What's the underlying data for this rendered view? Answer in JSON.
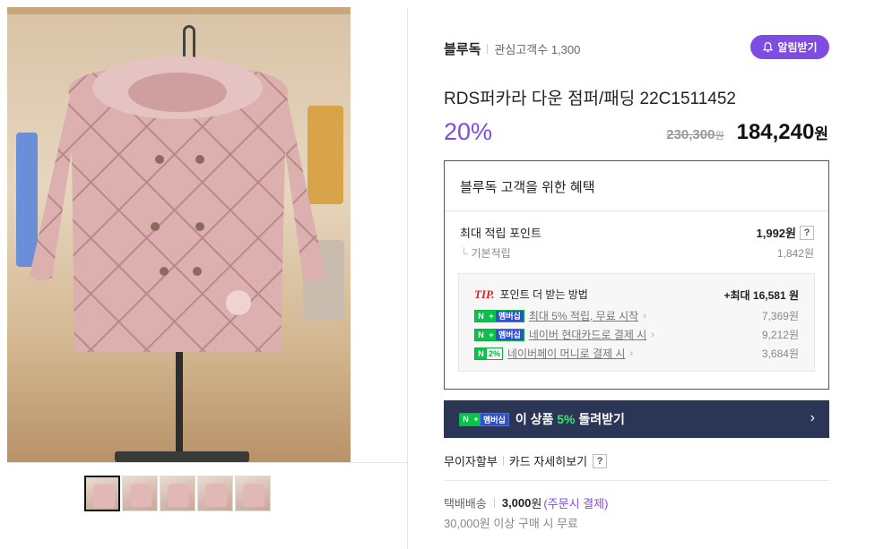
{
  "brand": {
    "name": "블루독",
    "fans_label": "관심고객수 1,300",
    "alarm_button": "알림받기",
    "accent_color": "#7e4ce0"
  },
  "product": {
    "title": "RDS퍼카라 다운 점퍼/패딩 22C1511452",
    "discount": "20%",
    "original_price": "230,300",
    "original_unit": "원",
    "sale_price": "184,240",
    "sale_unit": "원"
  },
  "gallery": {
    "main_image": "pink-quilted-down-jacket-photo",
    "thumbnails": [
      "thumbnail-1",
      "thumbnail-2",
      "thumbnail-3",
      "thumbnail-4",
      "thumbnail-5"
    ],
    "active_index": 0
  },
  "benefits": {
    "title": "블루독 고객을 위한 혜택",
    "max_points_label": "최대 적립 포인트",
    "max_points_value": "1,992원",
    "help_icon": "?",
    "base_label": "기본적립",
    "base_value": "1,842원",
    "tip": {
      "tag": "TIP.",
      "text": "포인트 더 받는 방법",
      "max_label": "+최대 16,581 원",
      "badge_member": "멤버십",
      "badge_pct": "2%",
      "rows": [
        {
          "label": "최대 5% 적립, 무료 시작",
          "value": "7,369원",
          "badge": "membership"
        },
        {
          "label": "네이버 현대카드로 결제 시",
          "value": "9,212원",
          "badge": "membership"
        },
        {
          "label": "네이버페이 머니로 결제 시",
          "value": "3,684원",
          "badge": "pct"
        }
      ]
    }
  },
  "cashback": {
    "pre": "이 상품 ",
    "pct": "5%",
    "post": " 돌려받기",
    "chevron": "›",
    "badge_member": "멤버십",
    "bar_color": "#2b3555"
  },
  "installment": {
    "label": "무이자할부",
    "link": "카드 자세히보기",
    "help_icon": "?"
  },
  "shipping": {
    "label": "택배배송",
    "fee": "3,000",
    "unit": "원",
    "note": "(주문시 결제)",
    "free_note": "30,000원 이상 구매 시 무료"
  }
}
